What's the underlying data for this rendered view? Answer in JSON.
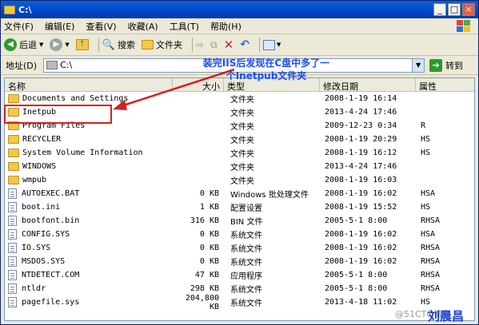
{
  "window": {
    "title": "C:\\"
  },
  "menu": {
    "items": [
      "文件(F)",
      "编辑(E)",
      "查看(V)",
      "收藏(A)",
      "工具(T)",
      "帮助(H)"
    ]
  },
  "toolbar": {
    "back": "后退",
    "search": "搜索",
    "folders": "文件夹"
  },
  "address": {
    "label": "地址(D)",
    "value": "C:\\",
    "go": "转到"
  },
  "columns": {
    "name": "名称",
    "size": "大小",
    "type": "类型",
    "modified": "修改日期",
    "attr": "属性"
  },
  "files": [
    {
      "name": "Documents and Settings",
      "size": "",
      "type": "文件夹",
      "date": "2008-1-19 16:14",
      "attr": "",
      "kind": "folder"
    },
    {
      "name": "Inetpub",
      "size": "",
      "type": "文件夹",
      "date": "2013-4-24 17:46",
      "attr": "",
      "kind": "folder"
    },
    {
      "name": "Program Files",
      "size": "",
      "type": "文件夹",
      "date": "2009-12-23 0:34",
      "attr": "R",
      "kind": "folder"
    },
    {
      "name": "RECYCLER",
      "size": "",
      "type": "文件夹",
      "date": "2008-1-19 20:29",
      "attr": "HS",
      "kind": "folder"
    },
    {
      "name": "System Volume Information",
      "size": "",
      "type": "文件夹",
      "date": "2008-1-19 16:12",
      "attr": "HS",
      "kind": "folder"
    },
    {
      "name": "WINDOWS",
      "size": "",
      "type": "文件夹",
      "date": "2013-4-24 17:46",
      "attr": "",
      "kind": "folder"
    },
    {
      "name": "wmpub",
      "size": "",
      "type": "文件夹",
      "date": "2008-1-19 16:03",
      "attr": "",
      "kind": "folder"
    },
    {
      "name": "AUTOEXEC.BAT",
      "size": "0 KB",
      "type": "Windows 批处理文件",
      "date": "2008-1-19 16:02",
      "attr": "HSA",
      "kind": "file"
    },
    {
      "name": "boot.ini",
      "size": "1 KB",
      "type": "配置设置",
      "date": "2008-1-19 15:52",
      "attr": "HS",
      "kind": "file"
    },
    {
      "name": "bootfont.bin",
      "size": "316 KB",
      "type": "BIN 文件",
      "date": "2005-5-1 8:00",
      "attr": "RHSA",
      "kind": "file"
    },
    {
      "name": "CONFIG.SYS",
      "size": "0 KB",
      "type": "系统文件",
      "date": "2008-1-19 16:02",
      "attr": "HSA",
      "kind": "file"
    },
    {
      "name": "IO.SYS",
      "size": "0 KB",
      "type": "系统文件",
      "date": "2008-1-19 16:02",
      "attr": "RHSA",
      "kind": "file"
    },
    {
      "name": "MSDOS.SYS",
      "size": "0 KB",
      "type": "系统文件",
      "date": "2008-1-19 16:02",
      "attr": "RHSA",
      "kind": "file"
    },
    {
      "name": "NTDETECT.COM",
      "size": "47 KB",
      "type": "应用程序",
      "date": "2005-5-1 8:00",
      "attr": "RHSA",
      "kind": "file"
    },
    {
      "name": "ntldr",
      "size": "298 KB",
      "type": "系统文件",
      "date": "2005-5-1 8:00",
      "attr": "RHSA",
      "kind": "file"
    },
    {
      "name": "pagefile.sys",
      "size": "204,800 KB",
      "type": "系统文件",
      "date": "2013-4-18 11:02",
      "attr": "HS",
      "kind": "file"
    }
  ],
  "annotation": {
    "line1": "装完IIS后发现在C盘中多了一",
    "line2": "个Inetpub文件夹"
  },
  "watermark": "@51CTO博客",
  "author": "刘晨昌",
  "colors": {
    "annotation": "#1a4cff",
    "highlight": "#d42020",
    "titlebar": "#0047c7"
  }
}
